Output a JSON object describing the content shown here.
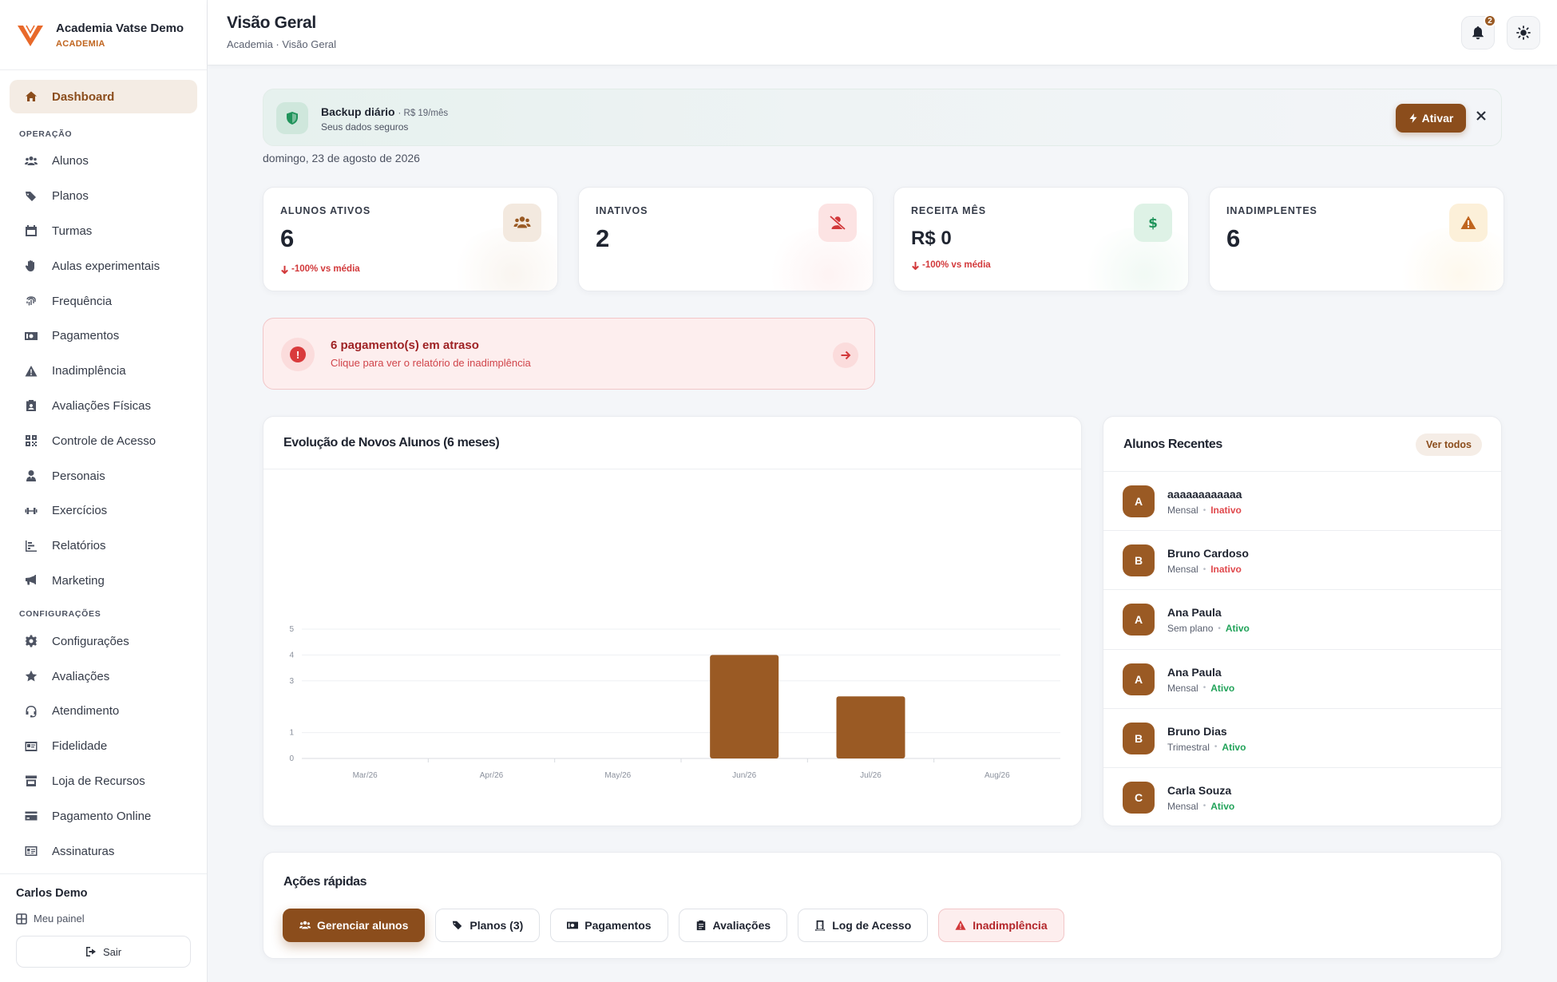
{
  "brand": {
    "name": "Academia Vatse Demo",
    "subtitle": "ACADEMIA"
  },
  "sidebar": {
    "dashboard": "Dashboard",
    "section_operacao": "OPERAÇÃO",
    "operacao": [
      {
        "label": "Alunos",
        "icon": "users-icon"
      },
      {
        "label": "Planos",
        "icon": "tags-icon"
      },
      {
        "label": "Turmas",
        "icon": "calendar-icon"
      },
      {
        "label": "Aulas experimentais",
        "icon": "hand-icon"
      },
      {
        "label": "Frequência",
        "icon": "fingerprint-icon"
      },
      {
        "label": "Pagamentos",
        "icon": "money-icon"
      },
      {
        "label": "Inadimplência",
        "icon": "warning-icon"
      },
      {
        "label": "Avaliações Físicas",
        "icon": "clipboard-icon"
      },
      {
        "label": "Controle de Acesso",
        "icon": "grid-icon"
      },
      {
        "label": "Personais",
        "icon": "user-tie-icon"
      },
      {
        "label": "Exercícios",
        "icon": "dumbbell-icon"
      },
      {
        "label": "Relatórios",
        "icon": "chart-icon"
      },
      {
        "label": "Marketing",
        "icon": "megaphone-icon"
      }
    ],
    "section_config": "CONFIGURAÇÕES",
    "configuracoes": [
      {
        "label": "Configurações",
        "icon": "gear-icon"
      },
      {
        "label": "Avaliações",
        "icon": "star-icon"
      },
      {
        "label": "Atendimento",
        "icon": "headset-icon"
      },
      {
        "label": "Fidelidade",
        "icon": "card-icon"
      },
      {
        "label": "Loja de Recursos",
        "icon": "store-icon"
      },
      {
        "label": "Pagamento Online",
        "icon": "credit-card-icon"
      },
      {
        "label": "Assinaturas",
        "icon": "id-card-icon"
      }
    ]
  },
  "user": {
    "name": "Carlos Demo",
    "panel": "Meu painel",
    "logout": "Sair"
  },
  "header": {
    "title": "Visão Geral",
    "breadcrumb": "Academia · Visão Geral",
    "notifications_count": "2"
  },
  "backup": {
    "title": "Backup diário",
    "price": "· R$ 19/mês",
    "subtitle": "Seus dados seguros",
    "button": "Ativar"
  },
  "date": "domingo, 23 de agosto de 2026",
  "stats": [
    {
      "label": "ALUNOS ATIVOS",
      "value": "6",
      "trend": "-100% vs média",
      "color": "#9a5a24"
    },
    {
      "label": "INATIVOS",
      "value": "2",
      "trend": "",
      "color": "#d2383a"
    },
    {
      "label": "RECEITA MÊS",
      "value": "R$ 0",
      "trend": "-100% vs média",
      "color": "#20945b"
    },
    {
      "label": "INADIMPLENTES",
      "value": "6",
      "trend": "",
      "color": "#c0651f"
    }
  ],
  "overdue": {
    "title": "6 pagamento(s) em atraso",
    "subtitle": "Clique para ver o relatório de inadimplência"
  },
  "chart_card": {
    "title": "Evolução de Novos Alunos (6 meses)"
  },
  "chart_data": {
    "type": "bar",
    "title": "Evolução de Novos Alunos (6 meses)",
    "categories": [
      "Mar/26",
      "Apr/26",
      "May/26",
      "Jun/26",
      "Jul/26",
      "Aug/26"
    ],
    "values": [
      0,
      0,
      0,
      4,
      2.4,
      0
    ],
    "yticks": [
      0,
      1,
      3,
      4,
      5
    ],
    "ylim": [
      0,
      5
    ],
    "grid": true,
    "bar_color": "#9a5a24"
  },
  "recent": {
    "title": "Alunos Recentes",
    "view_all": "Ver todos",
    "items": [
      {
        "initial": "A",
        "name": "aaaaaaaaaaaa",
        "plan": "Mensal",
        "status": "Inativo",
        "state": "inativo"
      },
      {
        "initial": "B",
        "name": "Bruno Cardoso",
        "plan": "Mensal",
        "status": "Inativo",
        "state": "inativo"
      },
      {
        "initial": "A",
        "name": "Ana Paula",
        "plan": "Sem plano",
        "status": "Ativo",
        "state": "ativo"
      },
      {
        "initial": "A",
        "name": "Ana Paula",
        "plan": "Mensal",
        "status": "Ativo",
        "state": "ativo"
      },
      {
        "initial": "B",
        "name": "Bruno Dias",
        "plan": "Trimestral",
        "status": "Ativo",
        "state": "ativo"
      },
      {
        "initial": "C",
        "name": "Carla Souza",
        "plan": "Mensal",
        "status": "Ativo",
        "state": "ativo"
      }
    ]
  },
  "actions": {
    "title": "Ações rápidas",
    "buttons": [
      {
        "label": "Gerenciar alunos",
        "icon": "users-icon"
      },
      {
        "label": "Planos (3)",
        "icon": "tags-icon"
      },
      {
        "label": "Pagamentos",
        "icon": "money-icon"
      },
      {
        "label": "Avaliações",
        "icon": "clipboard-icon"
      },
      {
        "label": "Log de Acesso",
        "icon": "door-icon"
      },
      {
        "label": "Inadimplência",
        "icon": "warning-icon"
      }
    ]
  }
}
